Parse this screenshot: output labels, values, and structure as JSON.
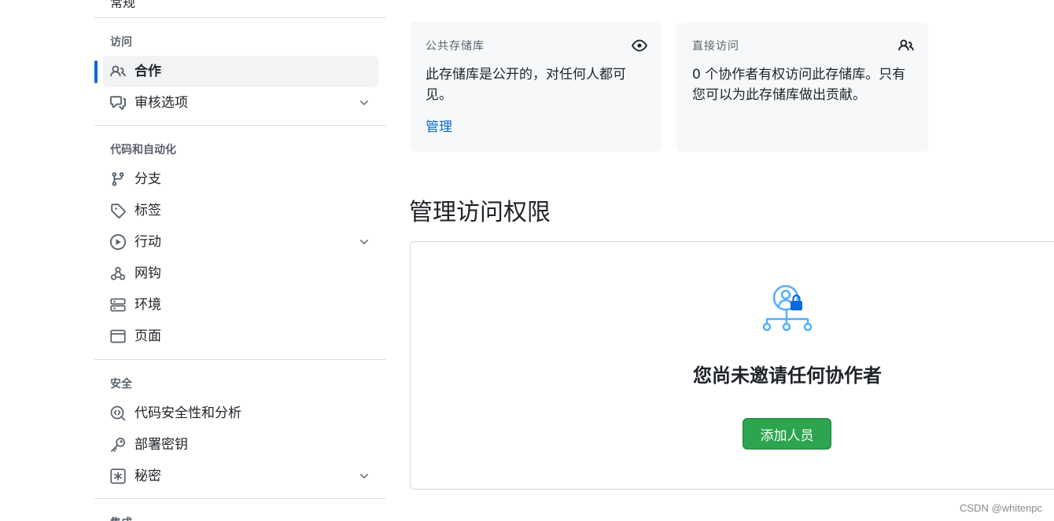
{
  "sidebar": {
    "clipped_item": "常规",
    "sections": [
      {
        "title": "访问"
      },
      {
        "title": "代码和自动化"
      },
      {
        "title": "安全"
      },
      {
        "title": "集成"
      }
    ],
    "items": [
      {
        "label": "合作",
        "icon": "people-icon",
        "active": true
      },
      {
        "label": "审核选项",
        "icon": "report-icon",
        "expandable": true
      },
      {
        "label": "分支",
        "icon": "git-branch-icon"
      },
      {
        "label": "标签",
        "icon": "tag-icon"
      },
      {
        "label": "行动",
        "icon": "play-icon",
        "expandable": true
      },
      {
        "label": "网钩",
        "icon": "webhook-icon"
      },
      {
        "label": "环境",
        "icon": "server-icon"
      },
      {
        "label": "页面",
        "icon": "browser-icon"
      },
      {
        "label": "代码安全性和分析",
        "icon": "codescan-icon"
      },
      {
        "label": "部署密钥",
        "icon": "key-icon"
      },
      {
        "label": "秘密",
        "icon": "asterisk-icon",
        "expandable": true
      }
    ]
  },
  "main": {
    "public_card": {
      "title": "公共存储库",
      "icon": "eye-icon",
      "body": "此存储库是公开的，对任何人都可见。",
      "link": "管理"
    },
    "direct_card": {
      "title": "直接访问",
      "icon": "people-icon",
      "body": "0 个协作者有权访问此存储库。只有您可以为此存储库做出贡献。"
    },
    "heading": "管理访问权限",
    "blankslate": {
      "icon": "collaborators-lock-icon",
      "title": "您尚未邀请任何协作者",
      "button": "添加人员"
    }
  },
  "watermark": "CSDN @whitenpc",
  "colors": {
    "accent": "#0969da",
    "primary_button": "#2da44e",
    "card_bg": "#f6f8fa",
    "active_item_bg": "#f2f3f5",
    "illustration_blue": "#54aeff"
  }
}
